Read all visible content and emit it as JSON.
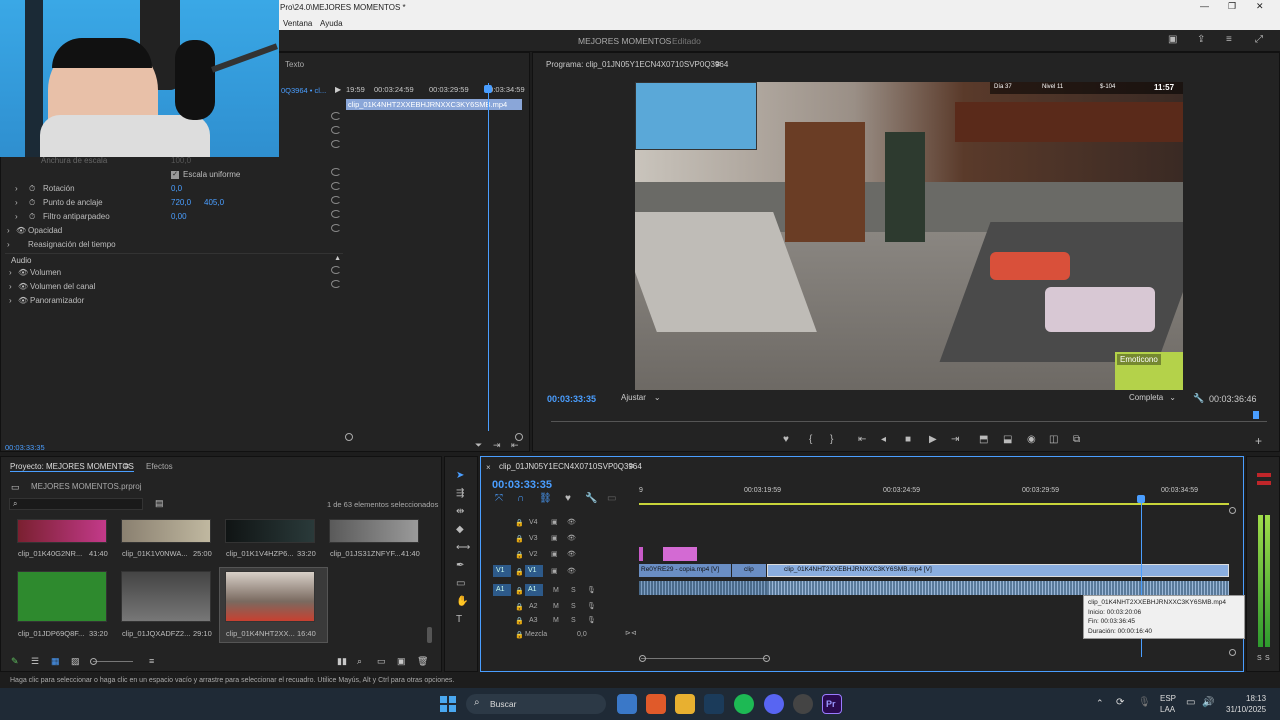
{
  "window": {
    "title_fragment": "Pro\\24.0\\MEJORES MOMENTOS *",
    "project_center": "MEJORES MOMENTOS",
    "edit_status": "Editado"
  },
  "menu": {
    "items": [
      "Ventana",
      "Ayuda"
    ]
  },
  "effect_controls": {
    "tab_text": "Texto",
    "source_clip": "0Q3964 • cl...",
    "timecodes": [
      "19:59",
      "00:03:24:59",
      "00:03:29:59",
      "00:03:34:59"
    ],
    "clip_bar": "clip_01K4NHT2XXEBHJRNXXC3KY6SMB.mp4",
    "properties": [
      {
        "label": "Anchura de escala",
        "value": "100,0"
      },
      {
        "label": "Escala uniforme",
        "checked": true
      },
      {
        "label": "Rotación",
        "value": "0,0"
      },
      {
        "label": "Punto de anclaje",
        "value": "720,0",
        "value2": "405,0"
      },
      {
        "label": "Filtro antiparpadeo",
        "value": "0,00"
      },
      {
        "label": "Opacidad"
      },
      {
        "label": "Reasignación del tiempo"
      }
    ],
    "audio_header": "Audio",
    "audio_props": [
      "Volumen",
      "Volumen del canal",
      "Panoramizador"
    ],
    "current_time": "00:03:33:35"
  },
  "program_monitor": {
    "title": "Programa: clip_01JN05Y1ECN4X0710SVP0Q3964",
    "timecode": "00:03:33:35",
    "fit": "Ajustar",
    "quality": "Completa",
    "duration": "00:03:36:46",
    "hud": {
      "day": "Día 37",
      "level": "Nivel 11",
      "money": "$-104",
      "clock": "11:57",
      "emote": "Emoticono"
    }
  },
  "project": {
    "tab_label": "Proyecto: MEJORES MOMENTOS",
    "effects_tab": "Efectos",
    "file": "MEJORES MOMENTOS.prproj",
    "selection": "1 de 63 elementos seleccionados",
    "items": [
      {
        "name": "clip_01K40G2NR...",
        "dur": "41:40"
      },
      {
        "name": "clip_01K1V0NWA...",
        "dur": "25:00"
      },
      {
        "name": "clip_01K1V4HZP6...",
        "dur": "33:20"
      },
      {
        "name": "clip_01JS31ZNFYF...",
        "dur": "41:40"
      },
      {
        "name": "clip_01JDP69Q8F...",
        "dur": "33:20"
      },
      {
        "name": "clip_01JQXADFZ2...",
        "dur": "29:10"
      },
      {
        "name": "clip_01K4NHT2XX...",
        "dur": "16:40"
      }
    ]
  },
  "timeline": {
    "sequence": "clip_01JN05Y1ECN4X0710SVP0Q3964",
    "timecode": "00:03:33:35",
    "ruler": [
      "9",
      "00:03:19:59",
      "00:03:24:59",
      "00:03:29:59",
      "00:03:34:59"
    ],
    "video_tracks": [
      "V4",
      "V3",
      "V2",
      "V1"
    ],
    "audio_tracks": [
      "A1",
      "A2",
      "A3"
    ],
    "mix_label": "Mezcla",
    "mix_value": "0,0",
    "clip_left": "Re0YRE29 - copia.mp4 [V]",
    "clip_mid": "clip",
    "clip_main": "clip_01K4NHT2XXEBHJRNXXC3KY6SMB.mp4 [V]",
    "tooltip": {
      "name": "clip_01K4NHT2XXEBHJRNXXC3KY6SMB.mp4",
      "start": "Inicio: 00:03:20:06",
      "end": "Fin: 00:03:36:45",
      "duration": "Duración: 00:00:16:40"
    }
  },
  "meters": {
    "labels": [
      "S",
      "S"
    ]
  },
  "status_bar": "Haga clic para seleccionar o haga clic en un espacio vacío y arrastre para seleccionar el recuadro. Utilice Mayús, Alt y Ctrl para otras opciones.",
  "taskbar": {
    "search": "Buscar",
    "lang1": "ESP",
    "lang2": "LAA",
    "time": "18:13",
    "date": "31/10/2025"
  }
}
